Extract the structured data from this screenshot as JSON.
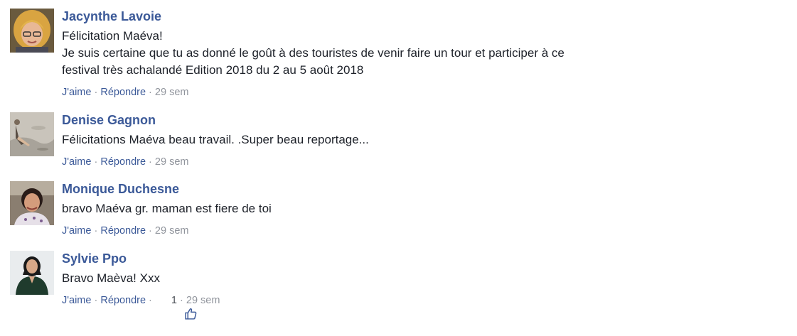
{
  "comments": [
    {
      "author": "Jacynthe Lavoie",
      "text": "Félicitation Maéva!\nJe suis certaine que tu as donné le goût à des touristes de venir faire un tour et participer à ce\nfestival très achalandé Edition 2018 du 2 au 5 août 2018",
      "actions": {
        "like": "J'aime",
        "reply": "Répondre",
        "sep": " · ",
        "time": "29 sem"
      }
    },
    {
      "author": "Denise Gagnon",
      "text": "Félicitations Maéva beau travail. .Super beau reportage...",
      "actions": {
        "like": "J'aime",
        "reply": "Répondre",
        "sep": " · ",
        "time": "29 sem"
      }
    },
    {
      "author": "Monique Duchesne",
      "text": "bravo Maéva gr. maman est fiere de toi",
      "actions": {
        "like": "J'aime",
        "reply": "Répondre",
        "sep": " · ",
        "time": "29 sem"
      }
    },
    {
      "author": "Sylvie Ppo",
      "text": "Bravo Maèva! Xxx",
      "actions": {
        "like": "J'aime",
        "reply": "Répondre",
        "sep": " · ",
        "time": "29 sem",
        "like_count": "1"
      }
    }
  ],
  "icons": {
    "like_reaction": "thumbs-up-icon"
  },
  "colors": {
    "link": "#3b5998",
    "text": "#1d2129",
    "meta": "#90949c"
  }
}
